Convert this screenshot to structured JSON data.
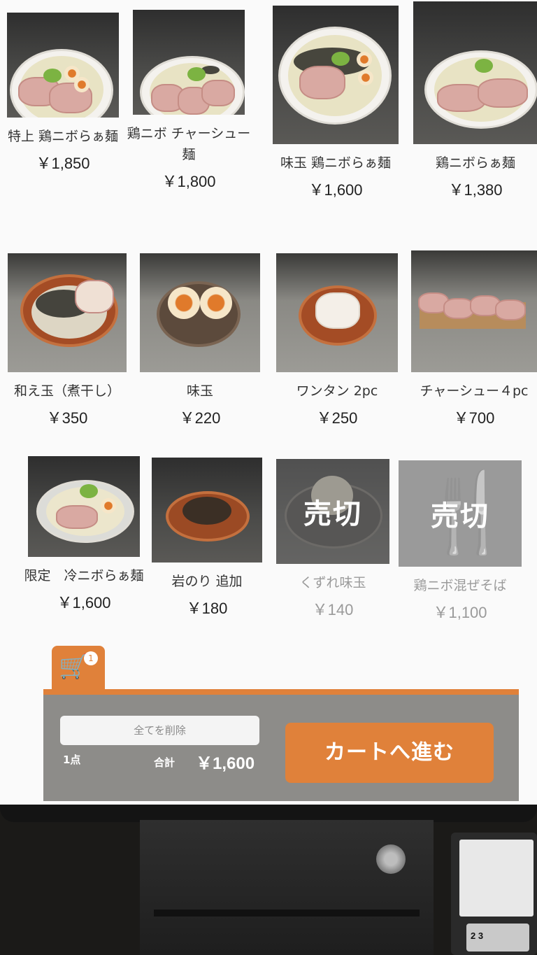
{
  "menu": {
    "items": [
      {
        "name": "特上 鶏ニボらぁ麺",
        "price": "￥1,850",
        "sold_out": false
      },
      {
        "name": "鶏ニボ チャーシュー麺",
        "price": "￥1,800",
        "sold_out": false
      },
      {
        "name": "味玉 鶏ニボらぁ麺",
        "price": "￥1,600",
        "sold_out": false
      },
      {
        "name": "鶏ニボらぁ麺",
        "price": "￥1,380",
        "sold_out": false
      },
      {
        "name": "和え玉（煮干し）",
        "price": "￥350",
        "sold_out": false
      },
      {
        "name": "味玉",
        "price": "￥220",
        "sold_out": false
      },
      {
        "name": "ワンタン 2pc",
        "price": "￥250",
        "sold_out": false
      },
      {
        "name": "チャーシュー４pc",
        "price": "￥700",
        "sold_out": false
      },
      {
        "name": "限定　冷ニボらぁ麺",
        "price": "￥1,600",
        "sold_out": false
      },
      {
        "name": "岩のり 追加",
        "price": "￥180",
        "sold_out": false
      },
      {
        "name": "くずれ味玉",
        "price": "￥140",
        "sold_out": true,
        "overlay": "売切"
      },
      {
        "name": "鶏ニボ混ぜそば",
        "price": "￥1,100",
        "sold_out": true,
        "overlay": "売切"
      }
    ]
  },
  "cart": {
    "badge_count": "1",
    "icon": "cart-icon",
    "clear_label": "全てを削除",
    "count_label": "1点",
    "total_label": "合計",
    "total_value": "￥1,600",
    "checkout_label": "カートへ進む"
  },
  "keypad": {
    "keys": "2 3"
  },
  "colors": {
    "accent": "#e0813a",
    "bar": "#8d8c89",
    "sold_out_text": "#9a9a9a"
  }
}
